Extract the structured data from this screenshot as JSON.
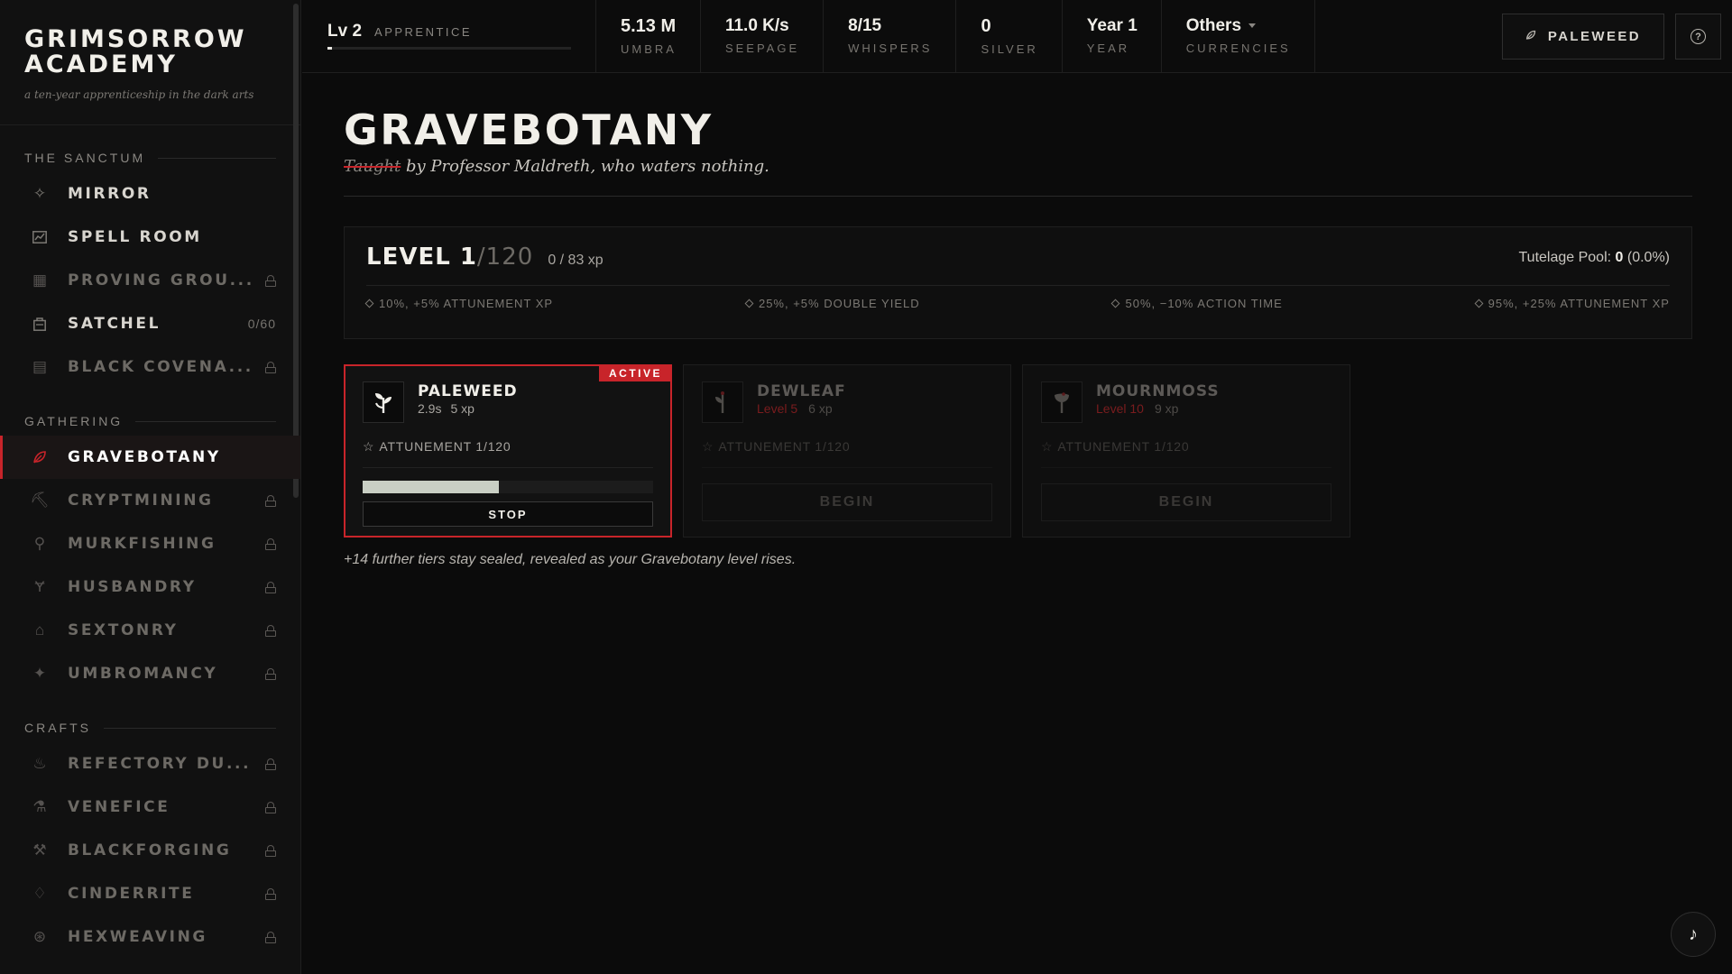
{
  "brand": {
    "title": "GRIMSORROW ACADEMY",
    "subtitle": "a ten-year apprenticeship in the dark arts"
  },
  "sidebar": {
    "sections": [
      {
        "label": "THE SANCTUM",
        "items": [
          {
            "label": "MIRROR",
            "icon": "sparkle-icon",
            "locked": false
          },
          {
            "label": "SPELL ROOM",
            "icon": "chart-icon",
            "locked": false
          },
          {
            "label": "PROVING GROU...",
            "icon": "grid-icon",
            "locked": true
          },
          {
            "label": "SATCHEL",
            "icon": "satchel-icon",
            "locked": false,
            "count": "0/60"
          },
          {
            "label": "BLACK COVENA...",
            "icon": "scroll-icon",
            "locked": true
          }
        ]
      },
      {
        "label": "GATHERING",
        "items": [
          {
            "label": "GRAVEBOTANY",
            "icon": "leaf-icon",
            "locked": false,
            "active": true
          },
          {
            "label": "CRYPTMINING",
            "icon": "pickaxe-icon",
            "locked": true
          },
          {
            "label": "MURKFISHING",
            "icon": "hook-icon",
            "locked": true
          },
          {
            "label": "HUSBANDRY",
            "icon": "sprout-icon",
            "locked": true
          },
          {
            "label": "SEXTONRY",
            "icon": "tombstone-icon",
            "locked": true
          },
          {
            "label": "UMBROMANCY",
            "icon": "star-icon",
            "locked": true
          }
        ]
      },
      {
        "label": "CRAFTS",
        "items": [
          {
            "label": "REFECTORY DU...",
            "icon": "cauldron-icon",
            "locked": true
          },
          {
            "label": "VENEFICE",
            "icon": "flask-icon",
            "locked": true
          },
          {
            "label": "BLACKFORGING",
            "icon": "hammer-icon",
            "locked": true
          },
          {
            "label": "CINDERRITE",
            "icon": "flame-icon",
            "locked": true
          },
          {
            "label": "HEXWEAVING",
            "icon": "spiral-icon",
            "locked": true
          }
        ]
      }
    ]
  },
  "topbar": {
    "level": "Lv 2",
    "rank": "APPRENTICE",
    "level_progress": 0.02,
    "stats": [
      {
        "value": "5.13 M",
        "label": "UMBRA"
      },
      {
        "value": "11.0 K/s",
        "label": "SEEPAGE"
      },
      {
        "value": "8/15",
        "label": "WHISPERS"
      },
      {
        "value": "0",
        "label": "SILVER"
      },
      {
        "value": "Year 1",
        "label": "YEAR"
      }
    ],
    "currencies": {
      "value": "Others",
      "label": "CURRENCIES"
    },
    "action_button": "PALEWEED",
    "help": "?"
  },
  "main": {
    "title": "GRAVEBOTANY",
    "subtitle_struck": "Taught",
    "subtitle_rest": " by Professor Maldreth, who waters nothing.",
    "level_panel": {
      "level": "LEVEL 1",
      "max": "/120",
      "xp": "0 / 83 xp",
      "pool_label": "Tutelage Pool: ",
      "pool_value": "0",
      "pool_pct": " (0.0%)",
      "milestones": [
        "10%, +5% ATTUNEMENT XP",
        "25%, +5% DOUBLE YIELD",
        "50%, −10% ACTION TIME",
        "95%, +25% ATTUNEMENT XP"
      ]
    },
    "cards": [
      {
        "name": "PALEWEED",
        "time": "2.9s",
        "xp": "5 xp",
        "attunement": "ATTUNEMENT 1/120",
        "badge": "ACTIVE",
        "progress": 0.47,
        "button": "STOP"
      },
      {
        "name": "DEWLEAF",
        "req": "Level 5",
        "xp": "6 xp",
        "attunement": "ATTUNEMENT 1/120",
        "button": "BEGIN"
      },
      {
        "name": "MOURNMOSS",
        "req": "Level 10",
        "xp": "9 xp",
        "attunement": "ATTUNEMENT 1/120",
        "button": "BEGIN"
      }
    ],
    "tiers_note": "+14 further tiers stay sealed, revealed as your Gravebotany level rises."
  },
  "music_button": "♪",
  "colors": {
    "accent": "#c8242a",
    "background": "#0b0b0b",
    "sidebar": "#111111"
  }
}
